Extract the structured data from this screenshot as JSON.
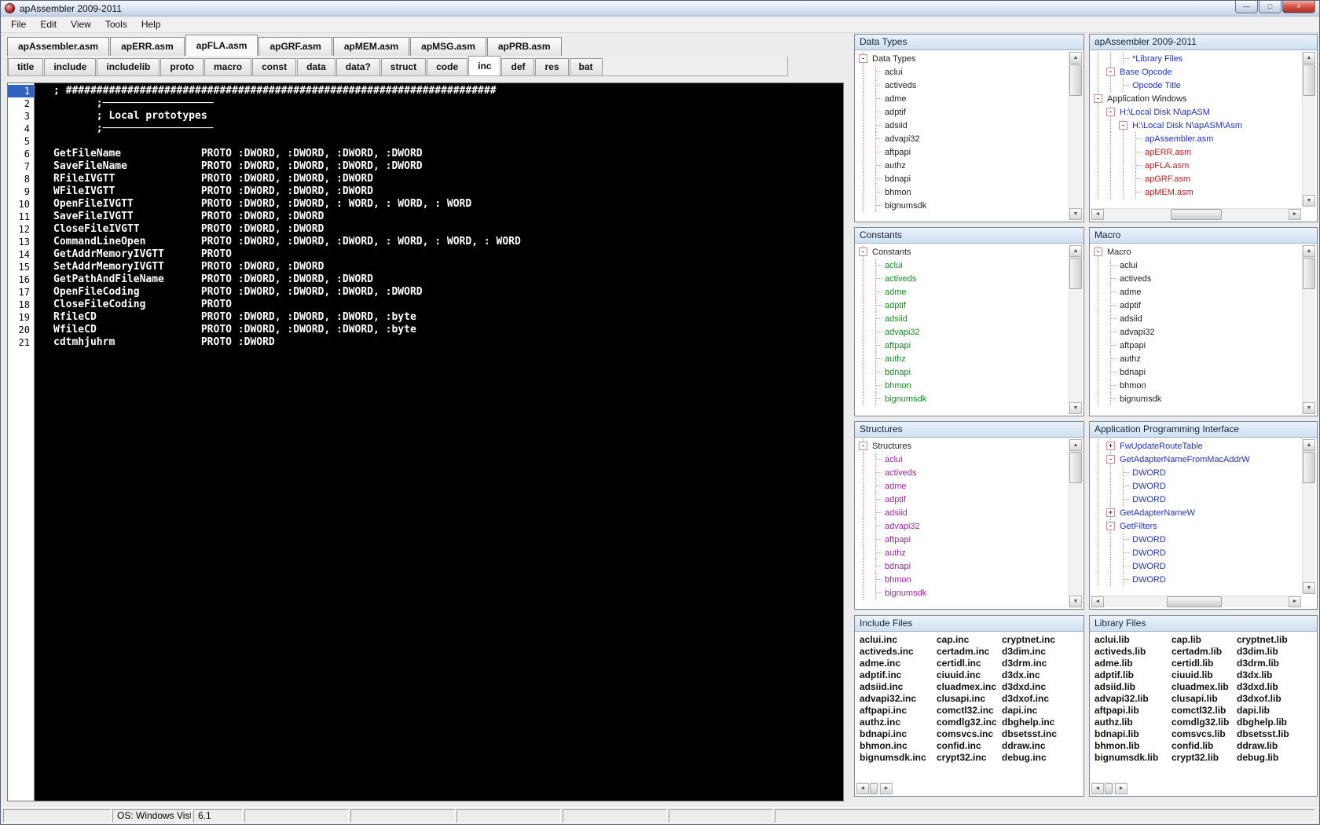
{
  "window": {
    "title": "apAssembler 2009-2011",
    "menu": [
      "File",
      "Edit",
      "View",
      "Tools",
      "Help"
    ],
    "controls": {
      "minimize": "—",
      "maximize": "□",
      "close": "×"
    }
  },
  "icons": {
    "scroll_up": "▲",
    "scroll_down": "▼",
    "scroll_left": "◄",
    "scroll_right": "►"
  },
  "file_tabs": {
    "active": "apFLA.asm",
    "items": [
      "apAssembler.asm",
      "apERR.asm",
      "apFLA.asm",
      "apGRF.asm",
      "apMEM.asm",
      "apMSG.asm",
      "apPRB.asm"
    ]
  },
  "section_tabs": {
    "active": "inc",
    "items": [
      "title",
      "include",
      "includelib",
      "proto",
      "macro",
      "const",
      "data",
      "data?",
      "struct",
      "code",
      "inc",
      "def",
      "res",
      "bat"
    ]
  },
  "editor": {
    "active_line": 1,
    "lines": [
      {
        "n": 1,
        "text": "; ######################################################################"
      },
      {
        "n": 2,
        "text": "       ;──────────────────"
      },
      {
        "n": 3,
        "text": "       ; Local prototypes"
      },
      {
        "n": 4,
        "text": "       ;──────────────────"
      },
      {
        "n": 5,
        "text": ""
      },
      {
        "n": 6,
        "text": "GetFileName             PROTO :DWORD, :DWORD, :DWORD, :DWORD"
      },
      {
        "n": 7,
        "text": "SaveFileName            PROTO :DWORD, :DWORD, :DWORD, :DWORD"
      },
      {
        "n": 8,
        "text": "RFileIVGTT              PROTO :DWORD, :DWORD, :DWORD"
      },
      {
        "n": 9,
        "text": "WFileIVGTT              PROTO :DWORD, :DWORD, :DWORD"
      },
      {
        "n": 10,
        "text": "OpenFileIVGTT           PROTO :DWORD, :DWORD, : WORD, : WORD, : WORD"
      },
      {
        "n": 11,
        "text": "SaveFileIVGTT           PROTO :DWORD, :DWORD"
      },
      {
        "n": 12,
        "text": "CloseFileIVGTT          PROTO :DWORD, :DWORD"
      },
      {
        "n": 13,
        "text": "CommandLineOpen         PROTO :DWORD, :DWORD, :DWORD, : WORD, : WORD, : WORD"
      },
      {
        "n": 14,
        "text": "GetAddrMemoryIVGTT      PROTO"
      },
      {
        "n": 15,
        "text": "SetAddrMemoryIVGTT      PROTO :DWORD, :DWORD"
      },
      {
        "n": 16,
        "text": "GetPathAndFileName      PROTO :DWORD, :DWORD, :DWORD"
      },
      {
        "n": 17,
        "text": "OpenFileCoding          PROTO :DWORD, :DWORD, :DWORD, :DWORD"
      },
      {
        "n": 18,
        "text": "CloseFileCoding         PROTO"
      },
      {
        "n": 19,
        "text": "RfileCD                 PROTO :DWORD, :DWORD, :DWORD, :byte"
      },
      {
        "n": 20,
        "text": "WfileCD                 PROTO :DWORD, :DWORD, :DWORD, :byte"
      },
      {
        "n": 21,
        "text": "cdtmhjuhrm              PROTO :DWORD"
      }
    ]
  },
  "panels": {
    "data_types": {
      "title": "Data Types",
      "nodes": [
        {
          "t": "Data Types",
          "l": 0,
          "b": "-",
          "c": "k"
        },
        {
          "t": "aclui",
          "l": 1,
          "c": "k"
        },
        {
          "t": "activeds",
          "l": 1,
          "c": "k"
        },
        {
          "t": "adme",
          "l": 1,
          "c": "k"
        },
        {
          "t": "adptif",
          "l": 1,
          "c": "k"
        },
        {
          "t": "adsiid",
          "l": 1,
          "c": "k"
        },
        {
          "t": "advapi32",
          "l": 1,
          "c": "k"
        },
        {
          "t": "aftpapi",
          "l": 1,
          "c": "k"
        },
        {
          "t": "authz",
          "l": 1,
          "c": "k"
        },
        {
          "t": "bdnapi",
          "l": 1,
          "c": "k"
        },
        {
          "t": "bhmon",
          "l": 1,
          "c": "k"
        },
        {
          "t": "bignumsdk",
          "l": 1,
          "c": "k"
        }
      ]
    },
    "constants": {
      "title": "Constants",
      "nodes": [
        {
          "t": "Constants",
          "l": 0,
          "b": "-",
          "c": "k"
        },
        {
          "t": "aclui",
          "l": 1,
          "c": "g"
        },
        {
          "t": "activeds",
          "l": 1,
          "c": "g"
        },
        {
          "t": "adme",
          "l": 1,
          "c": "g"
        },
        {
          "t": "adptif",
          "l": 1,
          "c": "g"
        },
        {
          "t": "adsiid",
          "l": 1,
          "c": "g"
        },
        {
          "t": "advapi32",
          "l": 1,
          "c": "g"
        },
        {
          "t": "aftpapi",
          "l": 1,
          "c": "g"
        },
        {
          "t": "authz",
          "l": 1,
          "c": "g"
        },
        {
          "t": "bdnapi",
          "l": 1,
          "c": "g"
        },
        {
          "t": "bhmon",
          "l": 1,
          "c": "g"
        },
        {
          "t": "bignumsdk",
          "l": 1,
          "c": "g"
        }
      ]
    },
    "structures": {
      "title": "Structures",
      "nodes": [
        {
          "t": "Structures",
          "l": 0,
          "b": "-",
          "c": "k"
        },
        {
          "t": "aclui",
          "l": 1,
          "c": "p"
        },
        {
          "t": "activeds",
          "l": 1,
          "c": "p"
        },
        {
          "t": "adme",
          "l": 1,
          "c": "p"
        },
        {
          "t": "adptif",
          "l": 1,
          "c": "p"
        },
        {
          "t": "adsiid",
          "l": 1,
          "c": "p"
        },
        {
          "t": "advapi32",
          "l": 1,
          "c": "p"
        },
        {
          "t": "aftpapi",
          "l": 1,
          "c": "p"
        },
        {
          "t": "authz",
          "l": 1,
          "c": "p"
        },
        {
          "t": "bdnapi",
          "l": 1,
          "c": "p"
        },
        {
          "t": "bhmon",
          "l": 1,
          "c": "p"
        },
        {
          "t": "bignumsdk",
          "l": 1,
          "c": "p"
        }
      ]
    },
    "macro": {
      "title": "Macro",
      "nodes": [
        {
          "t": "Macro",
          "l": 0,
          "b": "-",
          "c": "k"
        },
        {
          "t": "aclui",
          "l": 1,
          "c": "k"
        },
        {
          "t": "activeds",
          "l": 1,
          "c": "k"
        },
        {
          "t": "adme",
          "l": 1,
          "c": "k"
        },
        {
          "t": "adptif",
          "l": 1,
          "c": "k"
        },
        {
          "t": "adsiid",
          "l": 1,
          "c": "k"
        },
        {
          "t": "advapi32",
          "l": 1,
          "c": "k"
        },
        {
          "t": "aftpapi",
          "l": 1,
          "c": "k"
        },
        {
          "t": "authz",
          "l": 1,
          "c": "k"
        },
        {
          "t": "bdnapi",
          "l": 1,
          "c": "k"
        },
        {
          "t": "bhmon",
          "l": 1,
          "c": "k"
        },
        {
          "t": "bignumsdk",
          "l": 1,
          "c": "k"
        }
      ]
    },
    "assembler_tree": {
      "title": "apAssembler 2009-2011",
      "nodes": [
        {
          "t": "*Library Files",
          "l": 2,
          "c": "b"
        },
        {
          "t": "Base Opcode",
          "l": 1,
          "b": "-",
          "c": "b"
        },
        {
          "t": "Opcode Title",
          "l": 2,
          "c": "b"
        },
        {
          "t": "Application Windows",
          "l": 0,
          "b": "-",
          "c": "k"
        },
        {
          "t": "H:\\Local Disk N\\apASM",
          "l": 1,
          "b": "-",
          "c": "b"
        },
        {
          "t": "H:\\Local Disk N\\apASM\\Asm",
          "l": 2,
          "b": "-",
          "c": "b"
        },
        {
          "t": "apAssembler.asm",
          "l": 3,
          "c": "b"
        },
        {
          "t": "apERR.asm",
          "l": 3,
          "c": "r"
        },
        {
          "t": "apFLA.asm",
          "l": 3,
          "c": "r"
        },
        {
          "t": "apGRF.asm",
          "l": 3,
          "c": "r"
        },
        {
          "t": "apMEM.asm",
          "l": 3,
          "c": "r"
        }
      ]
    },
    "api": {
      "title": "Application Programming Interface",
      "nodes": [
        {
          "t": "FwUpdateRouteTable",
          "l": 1,
          "b": "+",
          "c": "b"
        },
        {
          "t": "GetAdapterNameFromMacAddrW",
          "l": 1,
          "b": "-",
          "c": "b"
        },
        {
          "t": "DWORD",
          "l": 2,
          "c": "b"
        },
        {
          "t": "DWORD",
          "l": 2,
          "c": "b"
        },
        {
          "t": "DWORD",
          "l": 2,
          "c": "b"
        },
        {
          "t": "GetAdapterNameW",
          "l": 1,
          "b": "+",
          "c": "b"
        },
        {
          "t": "GetFilters",
          "l": 1,
          "b": "-",
          "c": "b"
        },
        {
          "t": "DWORD",
          "l": 2,
          "c": "b"
        },
        {
          "t": "DWORD",
          "l": 2,
          "c": "b"
        },
        {
          "t": "DWORD",
          "l": 2,
          "c": "b"
        },
        {
          "t": "DWORD",
          "l": 2,
          "c": "b"
        }
      ]
    },
    "include_files": {
      "title": "Include Files",
      "columns": [
        [
          "aclui.inc",
          "activeds.inc",
          "adme.inc",
          "adptif.inc",
          "adsiid.inc",
          "advapi32.inc",
          "aftpapi.inc",
          "authz.inc",
          "bdnapi.inc",
          "bhmon.inc",
          "bignumsdk.inc"
        ],
        [
          "cap.inc",
          "certadm.inc",
          "certidl.inc",
          "ciuuid.inc",
          "cluadmex.inc",
          "clusapi.inc",
          "comctl32.inc",
          "comdlg32.inc",
          "comsvcs.inc",
          "confid.inc",
          "crypt32.inc"
        ],
        [
          "cryptnet.inc",
          "d3dim.inc",
          "d3drm.inc",
          "d3dx.inc",
          "d3dxd.inc",
          "d3dxof.inc",
          "dapi.inc",
          "dbghelp.inc",
          "dbsetsst.inc",
          "ddraw.inc",
          "debug.inc"
        ]
      ]
    },
    "library_files": {
      "title": "Library Files",
      "columns": [
        [
          "aclui.lib",
          "activeds.lib",
          "adme.lib",
          "adptif.lib",
          "adsiid.lib",
          "advapi32.lib",
          "aftpapi.lib",
          "authz.lib",
          "bdnapi.lib",
          "bhmon.lib",
          "bignumsdk.lib"
        ],
        [
          "cap.lib",
          "certadm.lib",
          "certidl.lib",
          "ciuuid.lib",
          "cluadmex.lib",
          "clusapi.lib",
          "comctl32.lib",
          "comdlg32.lib",
          "comsvcs.lib",
          "confid.lib",
          "crypt32.lib"
        ],
        [
          "cryptnet.lib",
          "d3dim.lib",
          "d3drm.lib",
          "d3dx.lib",
          "d3dxd.lib",
          "d3dxof.lib",
          "dapi.lib",
          "dbghelp.lib",
          "dbsetsst.lib",
          "ddraw.lib",
          "debug.lib"
        ]
      ]
    }
  },
  "status_bar": {
    "segments": [
      "",
      "OS: Windows Vista",
      "6.1",
      "",
      "",
      "",
      "",
      "",
      ""
    ]
  }
}
